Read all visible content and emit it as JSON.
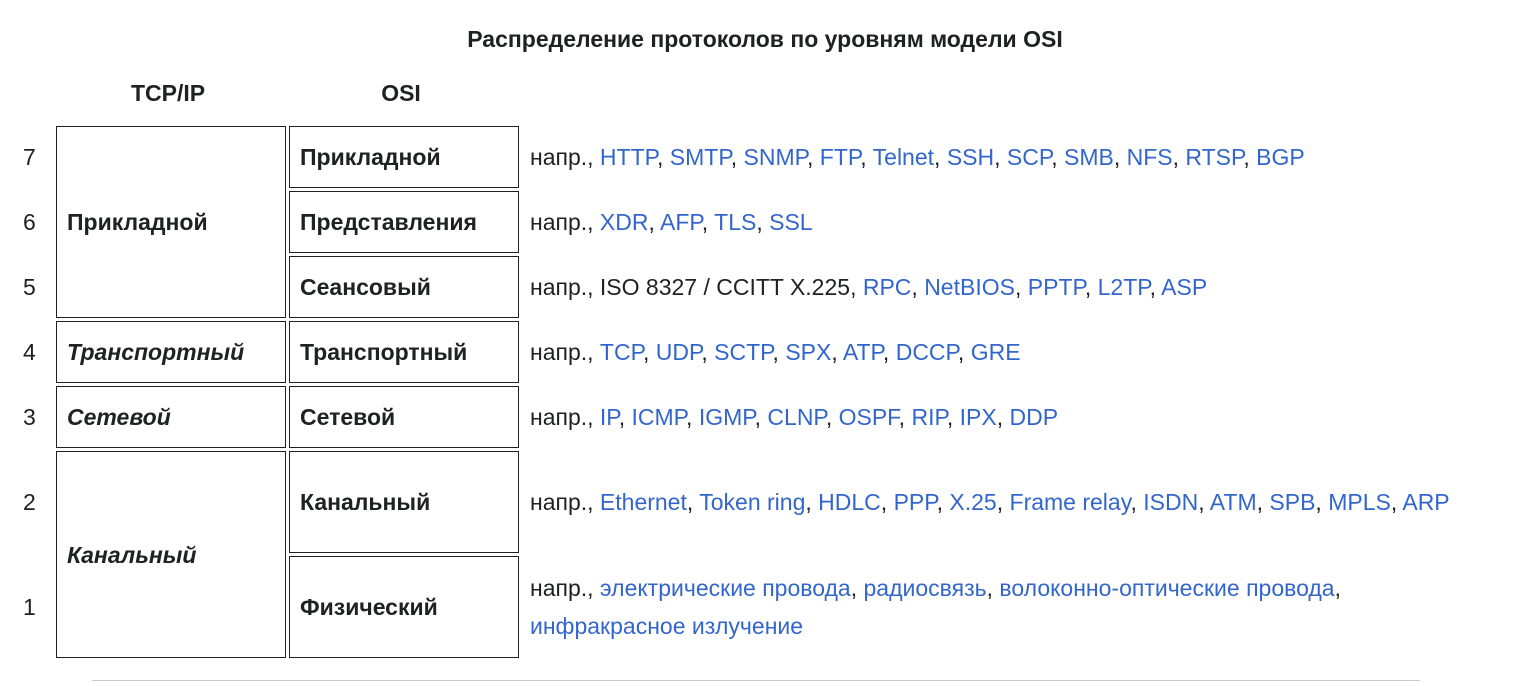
{
  "caption": "Распределение протоколов по уровням модели OSI",
  "headers": {
    "tcpip": "TCP/IP",
    "osi": "OSI"
  },
  "prefix": "напр.,",
  "tcpip_layers": {
    "application": "Прикладной",
    "transport": "Транспортный",
    "network": "Сетевой",
    "link": "Канальный"
  },
  "rows": [
    {
      "num": "7",
      "osi": "Прикладной",
      "protocols": [
        "HTTP",
        "SMTP",
        "SNMP",
        "FTP",
        "Telnet",
        "SSH",
        "SCP",
        "SMB",
        "NFS",
        "RTSP",
        "BGP"
      ]
    },
    {
      "num": "6",
      "osi": "Представления",
      "protocols": [
        "XDR",
        "AFP",
        "TLS",
        "SSL"
      ]
    },
    {
      "num": "5",
      "osi": "Сеансовый",
      "plain": "ISO 8327 / CCITT X.225",
      "protocols": [
        "RPC",
        "NetBIOS",
        "PPTP",
        "L2TP",
        "ASP"
      ]
    },
    {
      "num": "4",
      "osi": "Транспортный",
      "protocols": [
        "TCP",
        "UDP",
        "SCTP",
        "SPX",
        "ATP",
        "DCCP",
        "GRE"
      ]
    },
    {
      "num": "3",
      "osi": "Сетевой",
      "protocols": [
        "IP",
        "ICMP",
        "IGMP",
        "CLNP",
        "OSPF",
        "RIP",
        "IPX",
        "DDP"
      ]
    },
    {
      "num": "2",
      "osi": "Канальный",
      "protocols": [
        "Ethernet",
        "Token ring",
        "HDLC",
        "PPP",
        "X.25",
        "Frame relay",
        "ISDN",
        "ATM",
        "SPB",
        "MPLS",
        "ARP"
      ]
    },
    {
      "num": "1",
      "osi": "Физический",
      "protocols": [
        "электрические провода",
        "радиосвязь",
        "волоконно-оптические провода",
        "инфракрасное излучение"
      ]
    }
  ],
  "colors": {
    "link": "#3366cc",
    "text": "#202122",
    "border": "#202122"
  }
}
